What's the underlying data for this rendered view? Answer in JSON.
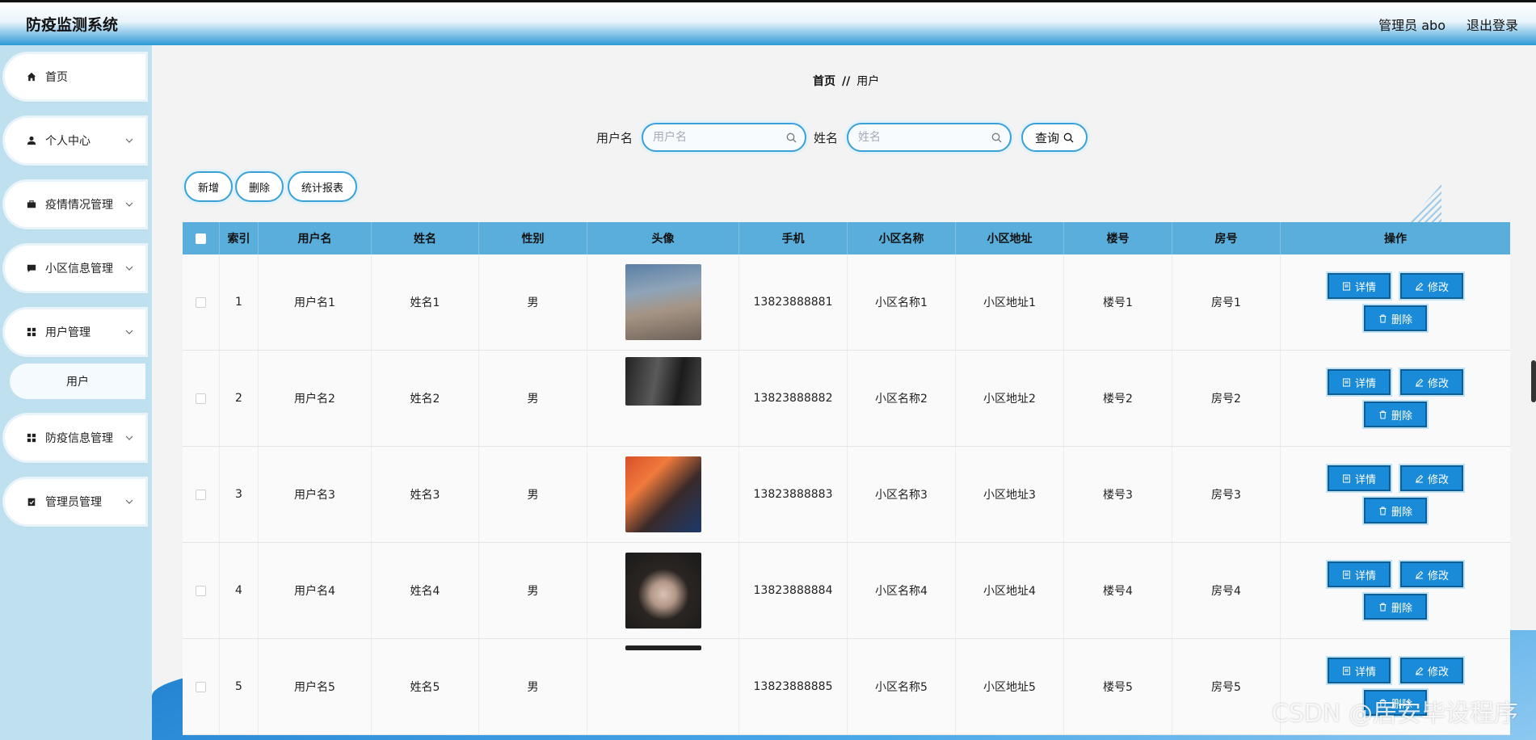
{
  "header": {
    "title": "防疫监测系统",
    "admin": "管理员 abo",
    "logout": "退出登录"
  },
  "sidebar": {
    "items": [
      {
        "label": "首页",
        "icon": "home-icon"
      },
      {
        "label": "个人中心",
        "icon": "user-icon"
      },
      {
        "label": "疫情情况管理",
        "icon": "briefcase-icon"
      },
      {
        "label": "小区信息管理",
        "icon": "chat-icon"
      },
      {
        "label": "用户管理",
        "icon": "grid-icon"
      },
      {
        "label": "防疫信息管理",
        "icon": "grid-icon"
      },
      {
        "label": "管理员管理",
        "icon": "clipboard-icon"
      }
    ],
    "sub_item": "用户"
  },
  "breadcrumb": {
    "home": "首页",
    "separator": "//",
    "current": "用户"
  },
  "search": {
    "username_label": "用户名",
    "username_placeholder": "用户名",
    "name_label": "姓名",
    "name_placeholder": "姓名",
    "query_label": "查询"
  },
  "actions": {
    "add": "新增",
    "delete": "删除",
    "report": "统计报表"
  },
  "table": {
    "headers": [
      "索引",
      "用户名",
      "姓名",
      "性别",
      "头像",
      "手机",
      "小区名称",
      "小区地址",
      "楼号",
      "房号",
      "操作"
    ],
    "rows": [
      {
        "idx": "1",
        "username": "用户名1",
        "name": "姓名1",
        "sex": "男",
        "phone": "13823888881",
        "cname": "小区名称1",
        "caddr": "小区地址1",
        "building": "楼号1",
        "room": "房号1"
      },
      {
        "idx": "2",
        "username": "用户名2",
        "name": "姓名2",
        "sex": "男",
        "phone": "13823888882",
        "cname": "小区名称2",
        "caddr": "小区地址2",
        "building": "楼号2",
        "room": "房号2"
      },
      {
        "idx": "3",
        "username": "用户名3",
        "name": "姓名3",
        "sex": "男",
        "phone": "13823888883",
        "cname": "小区名称3",
        "caddr": "小区地址3",
        "building": "楼号3",
        "room": "房号3"
      },
      {
        "idx": "4",
        "username": "用户名4",
        "name": "姓名4",
        "sex": "男",
        "phone": "13823888884",
        "cname": "小区名称4",
        "caddr": "小区地址4",
        "building": "楼号4",
        "room": "房号4"
      },
      {
        "idx": "5",
        "username": "用户名5",
        "name": "姓名5",
        "sex": "男",
        "phone": "13823888885",
        "cname": "小区名称5",
        "caddr": "小区地址5",
        "building": "楼号5",
        "room": "房号5"
      }
    ],
    "op_detail": "详情",
    "op_edit": "修改",
    "op_delete": "删除"
  },
  "watermark": "CSDN @居安毕设程序",
  "colors": {
    "accent": "#1a8bd8",
    "header_blue": "#2d9ad6",
    "sidebar_bg": "#bfe0ee",
    "table_head": "#5aaedb"
  }
}
